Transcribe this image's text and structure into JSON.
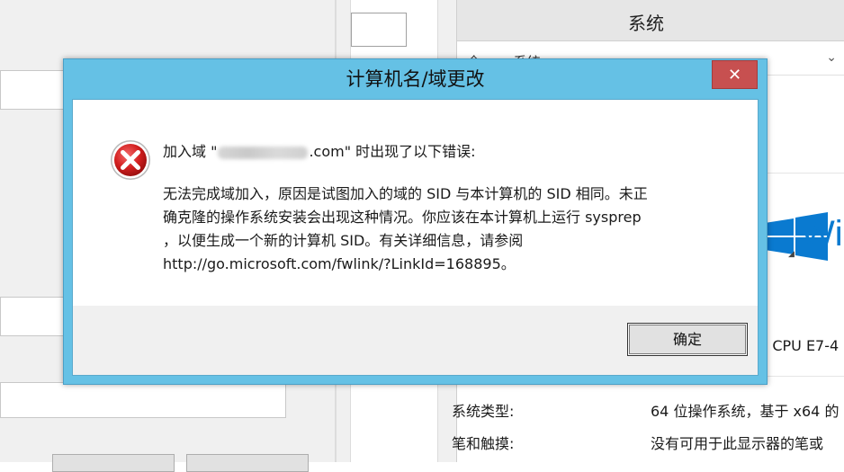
{
  "dialog": {
    "title": "计算机名/域更改",
    "close_label": "✕",
    "message": {
      "heading_prefix": "加入域 \"",
      "heading_suffix": ".com\" 时出现了以下错误:",
      "body_lines": [
        "无法完成域加入，原因是试图加入的域的 SID 与本计算机的 SID 相同。未正",
        "确克隆的操作系统安装会出现这种情况。你应该在本计算机上运行 sysprep",
        "，以便生成一个新的计算机 SID。有关详细信息，请参阅",
        "http://go.microsoft.com/fwlink/?LinkId=168895。"
      ]
    },
    "ok_label": "确定"
  },
  "system_window": {
    "title": "系统",
    "address_text": "«全... > 系统",
    "logo_text": "Wir",
    "cpu_fragment": ") CPU E7-4",
    "rows": [
      {
        "label": "系统类型:",
        "value": "64 位操作系统，基于 x64 的"
      },
      {
        "label": "笔和触摸:",
        "value": "没有可用于此显示器的笔或"
      }
    ]
  },
  "colors": {
    "dialog_frame": "#65c1e5",
    "close_button": "#c75050",
    "error_icon": "#d32020",
    "windows_logo": "#0a7ad0"
  }
}
